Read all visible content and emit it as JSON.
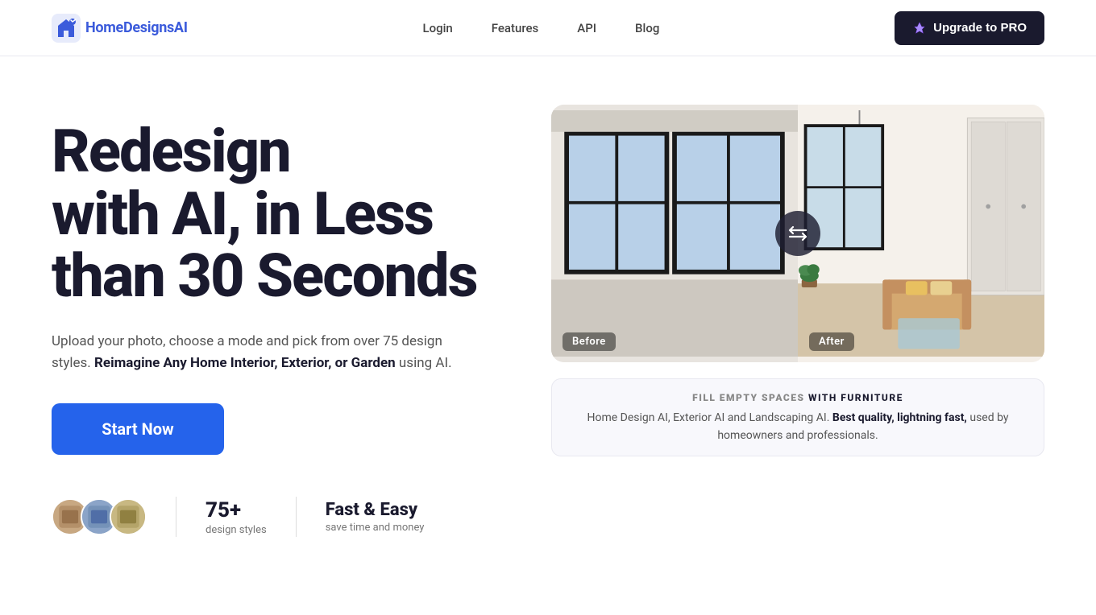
{
  "nav": {
    "logo_text_part1": "Home",
    "logo_text_part2": "DesignsAI",
    "links": [
      {
        "id": "login",
        "label": "Login",
        "href": "#"
      },
      {
        "id": "features",
        "label": "Features",
        "href": "#"
      },
      {
        "id": "api",
        "label": "API",
        "href": "#"
      },
      {
        "id": "blog",
        "label": "Blog",
        "href": "#"
      }
    ],
    "upgrade_label": "Upgrade to PRO"
  },
  "hero": {
    "heading_line1": "Redesign",
    "heading_line2": "with AI, in Less",
    "heading_line3": "than 30 Seconds",
    "subtext_plain": "Upload your photo, choose a mode and pick from over 75 design styles.",
    "subtext_bold": "Reimagine Any Home Interior, Exterior, or Garden",
    "subtext_end": " using AI.",
    "cta_label": "Start Now"
  },
  "stats": {
    "count_number": "75+",
    "count_label": "design styles",
    "fast_title": "Fast & Easy",
    "fast_sub": "save time and money"
  },
  "before_after": {
    "before_label": "Before",
    "after_label": "After",
    "swap_icon": "⇄"
  },
  "bottom_bar": {
    "fill_label_bold": "FILL EMPTY SPACES",
    "fill_label_rest": " WITH FURNITURE",
    "description_plain": "Home Design AI, Exterior AI and Landscaping AI.",
    "description_bold": "Best quality, lightning fast,",
    "description_mid": " used by homeowners and professionals."
  },
  "colors": {
    "accent": "#2563eb",
    "dark": "#1a1a2e",
    "nav_border": "#e8e8f0"
  }
}
